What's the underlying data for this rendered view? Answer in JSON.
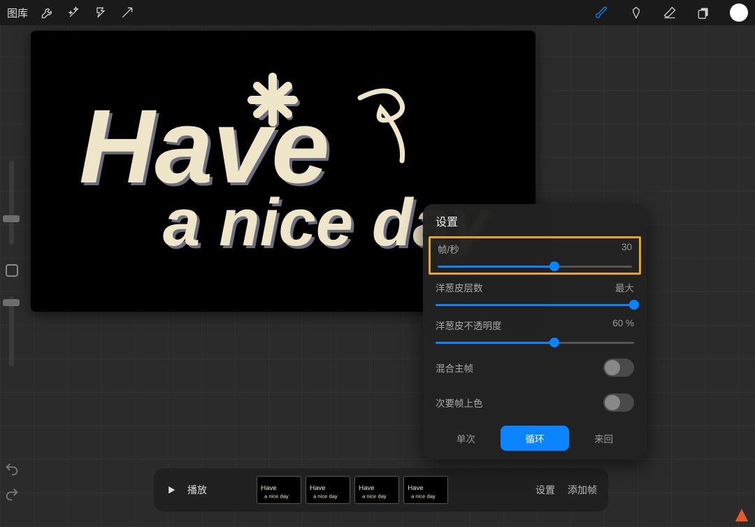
{
  "topbar": {
    "gallery_label": "图库",
    "icons": [
      "wrench",
      "wand",
      "transform",
      "arrow"
    ],
    "right_icons": [
      "brush",
      "smudge",
      "eraser",
      "layers"
    ],
    "current_color": "#ffffff"
  },
  "canvas": {
    "text_content": "Have a nice day",
    "ink_color": "#efe6c9",
    "shadow_color": "#6d6d80"
  },
  "settings_panel": {
    "title": "设置",
    "fps": {
      "label": "帧/秒",
      "value": 30,
      "min": 1,
      "max": 60,
      "pct": 60
    },
    "onion_layers": {
      "label": "洋葱皮层数",
      "value_text": "最大",
      "pct": 100
    },
    "onion_opacity": {
      "label": "洋葱皮不透明度",
      "value_text": "60 %",
      "pct": 60
    },
    "blend_primary": {
      "label": "混合主帧",
      "on": false
    },
    "tint_secondary": {
      "label": "次要帧上色",
      "on": false
    },
    "loop_modes": {
      "items": [
        "单次",
        "循环",
        "来回"
      ],
      "active_index": 1
    }
  },
  "timeline": {
    "play_label": "播放",
    "settings_label": "设置",
    "add_frame_label": "添加帧",
    "frame_count": 4
  }
}
